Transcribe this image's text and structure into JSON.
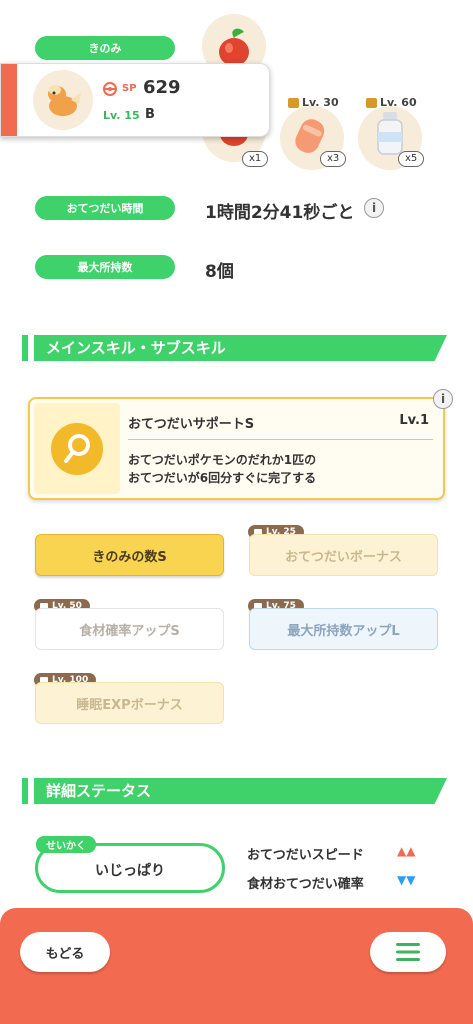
{
  "labels": {
    "berry": "きのみ",
    "help_time": "おてつだい時間",
    "max_carry": "最大所持数"
  },
  "values": {
    "help_time": "1時間2分41秒ごと",
    "max_carry": "8個"
  },
  "popup": {
    "sp_label": "SP",
    "sp_value": "629",
    "level": "Lv. 15",
    "grade": "B"
  },
  "ingredients": [
    {
      "unlock": "",
      "count": "x1",
      "icon": "apple-icon"
    },
    {
      "unlock": "Lv. 30",
      "count": "x3",
      "icon": "sausage-icon"
    },
    {
      "unlock": "Lv. 60",
      "count": "x5",
      "icon": "milk-icon"
    }
  ],
  "sections": {
    "skills": "メインスキル・サブスキル",
    "details": "詳細ステータス"
  },
  "main_skill": {
    "name": "おてつだいサポートS",
    "level": "Lv.1",
    "desc_line1": "おてつだいポケモンのだれか1匹の",
    "desc_line2": "おてつだいが6回分すぐに完了する"
  },
  "sub_skills": [
    {
      "label": "きのみの数S",
      "unlock": ""
    },
    {
      "label": "おてつだいボーナス",
      "unlock": "Lv. 25"
    },
    {
      "label": "食材確率アップS",
      "unlock": "Lv. 50"
    },
    {
      "label": "最大所持数アップL",
      "unlock": "Lv. 75"
    },
    {
      "label": "睡眠EXPボーナス",
      "unlock": "Lv. 100"
    }
  ],
  "nature": {
    "tag": "せいかく",
    "name": "いじっぱり",
    "up_label": "おてつだいスピード",
    "up_arrows": "▲▲",
    "down_label": "食材おてつだい確率",
    "down_arrows": "▼▼"
  },
  "footer": {
    "back": "もどる"
  },
  "colors": {
    "green": "#3fd16a",
    "coral": "#f26a4f",
    "gold": "#f2c94c",
    "up": "#f26a4f",
    "down": "#2f9df2"
  }
}
